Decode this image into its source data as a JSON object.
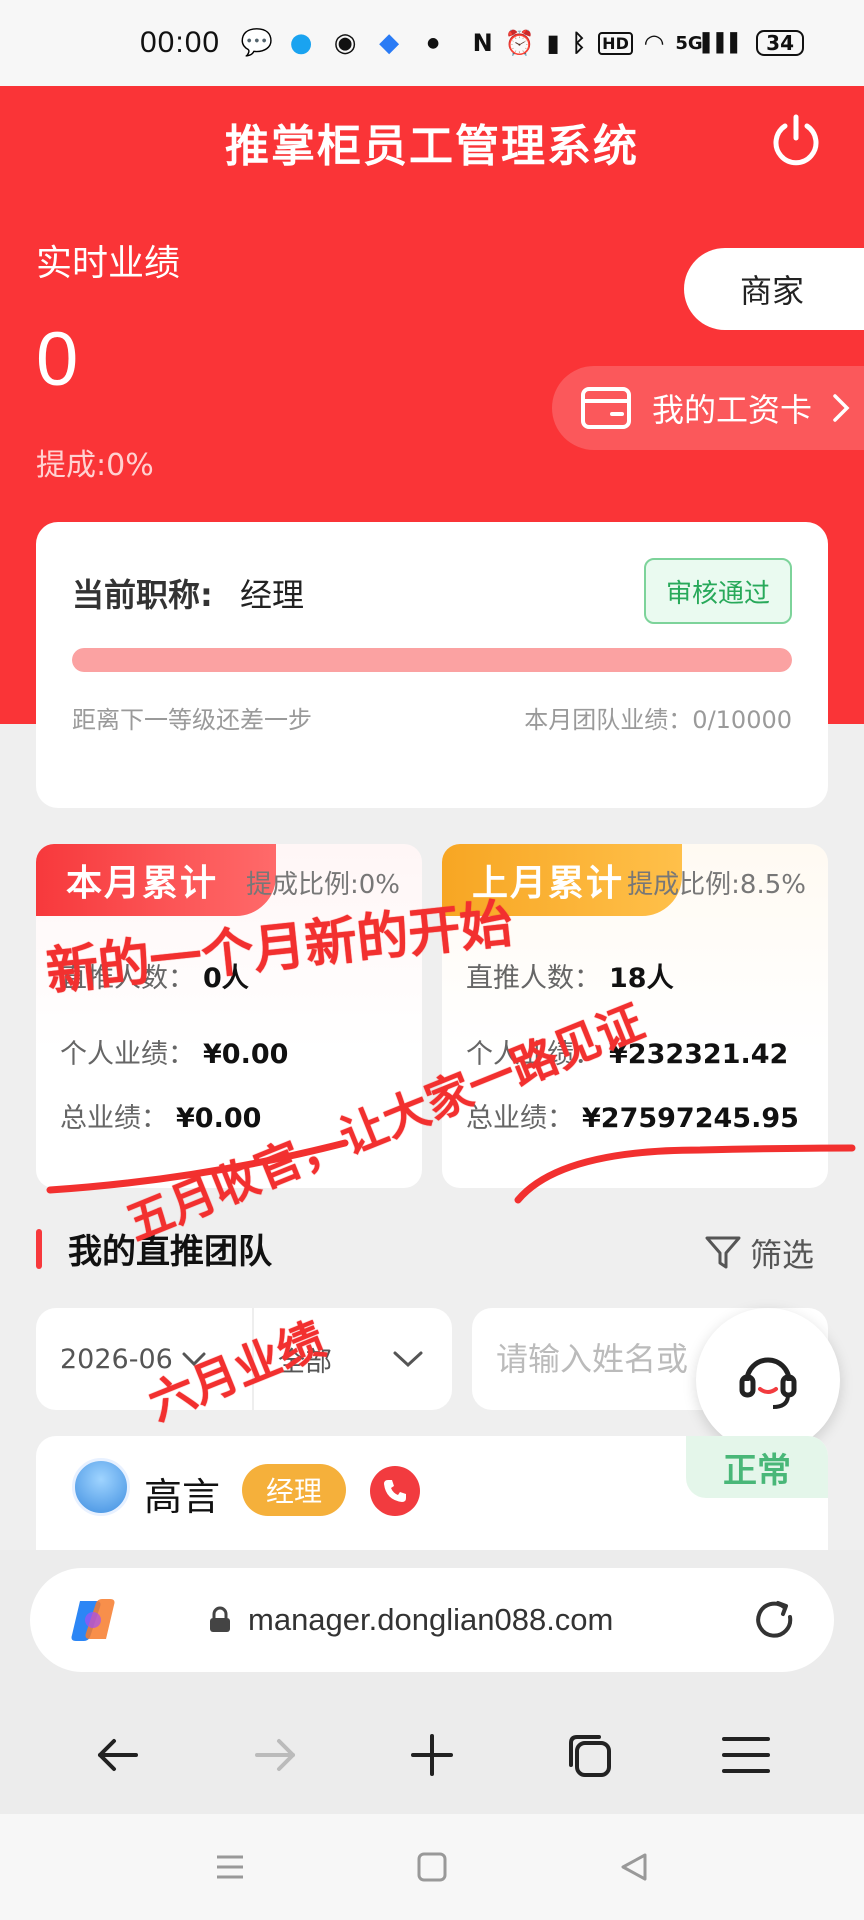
{
  "status_bar": {
    "time": "00:00",
    "network": "5G",
    "hd": "HD",
    "battery": "34"
  },
  "header": {
    "title": "推掌柜员工管理系统",
    "realtime_label": "实时业绩",
    "realtime_value": "0",
    "commission": "提成:0%",
    "merchant_button": "商家",
    "salary_card_button": "我的工资卡"
  },
  "title_card": {
    "label": "当前职称:",
    "value": "经理",
    "review_status": "审核通过",
    "progress": 0,
    "level_hint": "距离下一等级还差一步",
    "team_performance": "本月团队业绩：0/10000"
  },
  "this_month": {
    "tag": "本月累计",
    "ratio": "提成比例:0%",
    "direct_label": "直推人数：",
    "direct_value": "0人",
    "personal_label": "个人业绩：",
    "personal_value": "¥0.00",
    "total_label": "总业绩：",
    "total_value": "¥0.00"
  },
  "last_month": {
    "tag": "上月累计",
    "ratio": "提成比例:8.5%",
    "direct_label": "直推人数：",
    "direct_value": "18人",
    "personal_label": "个人业绩：",
    "personal_value": "¥232321.42",
    "total_label": "总业绩：",
    "total_value": "¥27597245.95"
  },
  "team": {
    "section_title": "我的直推团队",
    "filter_label": "筛选",
    "date_value": "2026-06",
    "range_value": "全部",
    "search_placeholder": "请输入姓名或"
  },
  "member": {
    "name": "高言",
    "role": "经理",
    "status": "正常"
  },
  "browser": {
    "url": "manager.donglian088.com"
  },
  "overlay": {
    "line1": "新的一个月新的开始",
    "line2": "五月收官，让大家一路见证",
    "line3": "六月业绩"
  },
  "colors": {
    "brand_red": "#fa3437",
    "status_green": "#28a95a",
    "role_orange": "#f5b03b",
    "scribble_red": "#f2302f"
  }
}
